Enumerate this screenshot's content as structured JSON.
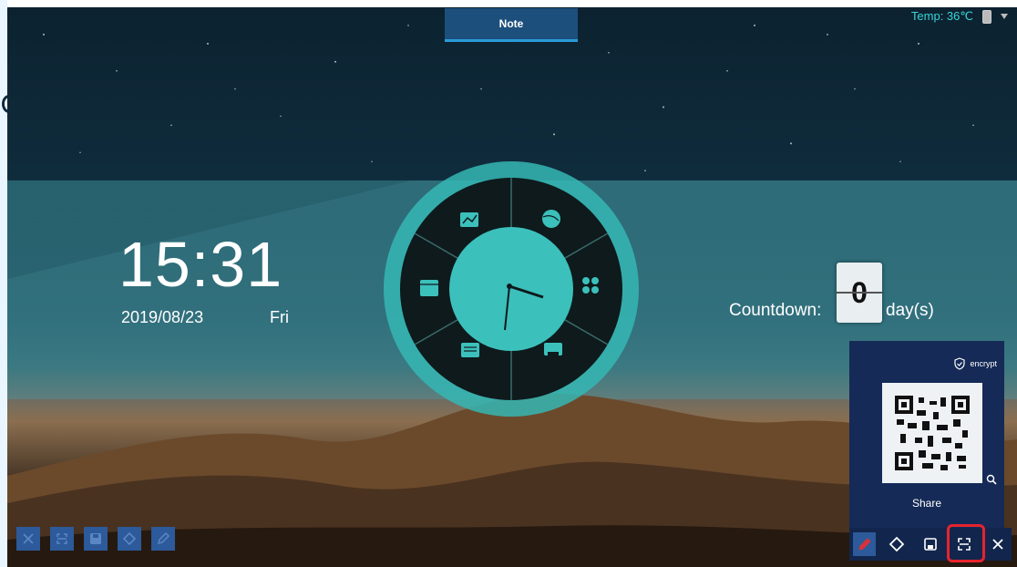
{
  "note_tab": {
    "label": "Note"
  },
  "status": {
    "temp": "Temp: 36℃",
    "usb_icon": "usb-icon",
    "wifi_icon": "wifi-icon"
  },
  "clock": {
    "time": "15:31",
    "date": "2019/08/23",
    "weekday": "Fri"
  },
  "countdown": {
    "label": "Countdown:",
    "value": "0",
    "unit": "day(s)"
  },
  "wheel": {
    "segments": [
      "chart-icon",
      "globe-icon",
      "apps-icon",
      "printer-icon",
      "document-icon",
      "calendar-icon"
    ],
    "colors": {
      "ring": "#35b7b4",
      "inner": "#0e1a1c",
      "hub": "#3cc0bc"
    }
  },
  "share_panel": {
    "encrypt_label": "encrypt",
    "share_label": "Share",
    "zoom_icon": "zoom-icon"
  },
  "toolbar_left": [
    "close-icon",
    "screenshot-icon",
    "save-icon",
    "eraser-icon",
    "pen-icon"
  ],
  "toolbar_right": [
    "pen-icon",
    "eraser-icon",
    "save-icon",
    "screenshot-icon",
    "close-icon"
  ],
  "colors": {
    "accent": "#2a9ad8",
    "panel": "#152a56",
    "highlight": "#e8232d",
    "temp_text": "#36d4d8"
  }
}
